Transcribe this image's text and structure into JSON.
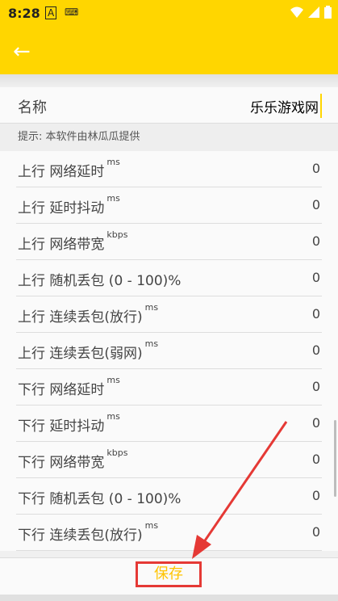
{
  "status": {
    "time": "8:28",
    "icon1": "A"
  },
  "appbar": {
    "back_icon": "←"
  },
  "name_row": {
    "label": "名称",
    "value": "乐乐游戏网"
  },
  "hint": "提示: 本软件由林瓜瓜提供",
  "rows": [
    {
      "label": "上行 网络延时",
      "unit": "ms",
      "value": "0"
    },
    {
      "label": "上行 延时抖动",
      "unit": "ms",
      "value": "0"
    },
    {
      "label": "上行 网络带宽",
      "unit": "kbps",
      "value": "0"
    },
    {
      "label": "上行 随机丢包 (0 - 100)%",
      "unit": "",
      "value": "0"
    },
    {
      "label": "上行 连续丢包(放行)",
      "unit": "ms",
      "value": "0"
    },
    {
      "label": "上行 连续丢包(弱网)",
      "unit": "ms",
      "value": "0"
    },
    {
      "label": "下行 网络延时",
      "unit": "ms",
      "value": "0"
    },
    {
      "label": "下行 延时抖动",
      "unit": "ms",
      "value": "0"
    },
    {
      "label": "下行 网络带宽",
      "unit": "kbps",
      "value": "0"
    },
    {
      "label": "下行 随机丢包 (0 - 100)%",
      "unit": "",
      "value": "0"
    },
    {
      "label": "下行 连续丢包(放行)",
      "unit": "ms",
      "value": "0"
    }
  ],
  "save_label": "保存",
  "colors": {
    "accent": "#ffd600",
    "highlight": "#e53935",
    "save_text": "#ffc400"
  }
}
